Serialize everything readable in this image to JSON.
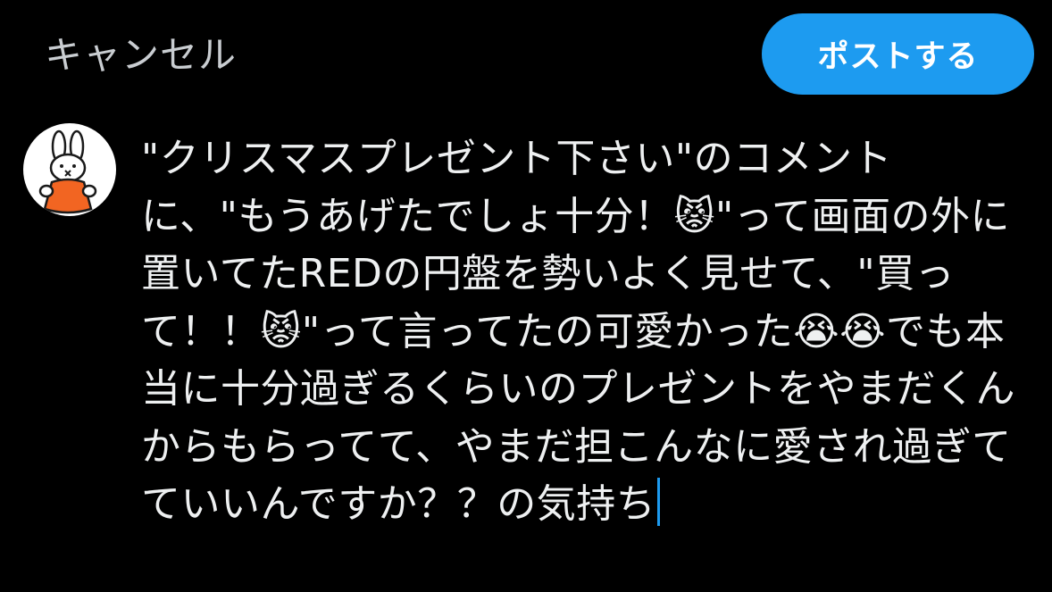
{
  "header": {
    "cancel_label": "キャンセル",
    "post_label": "ポストする"
  },
  "composer": {
    "text": "\"クリスマスプレゼント下さい\"のコメントに、\"もうあげたでしょ十分！😾\"って画面の外に置いてたREDの円盤を勢いよく見せて、\"買って！！😾\"って言ってたの可愛かった😭😭でも本当に十分過ぎるくらいのプレゼントをやまだくんからもらってて、やまだ担こんなに愛され過ぎてていいんですか？？の気持ち"
  },
  "avatar": {
    "icon": "rabbit-avatar"
  },
  "colors": {
    "background": "#000000",
    "accent": "#1d9bf0",
    "text": "#eef0f1",
    "muted": "#c9cdd1"
  }
}
